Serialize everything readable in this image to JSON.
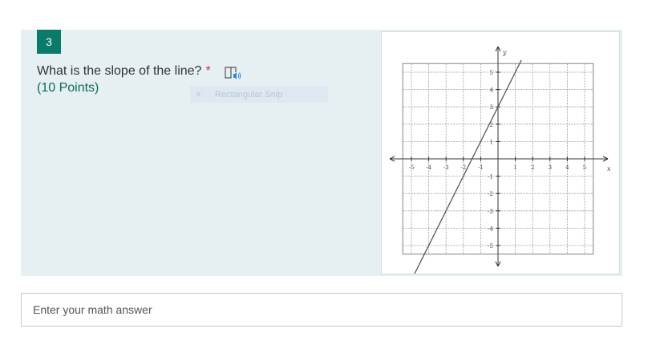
{
  "question": {
    "number": "3",
    "text": "What is the slope of the line?",
    "required_mark": "*",
    "points": "(10 Points)",
    "reader_icon": "immersive-reader-icon"
  },
  "snip_overlay": {
    "label": "Rectangular Snip"
  },
  "graph": {
    "x_label": "x",
    "y_label": "y",
    "x_ticks": [
      "-5",
      "-4",
      "-3",
      "-2",
      "-1",
      "1",
      "2",
      "3",
      "4",
      "5"
    ],
    "y_ticks": [
      "5",
      "4",
      "3",
      "2",
      "1",
      "-1",
      "-2",
      "-3",
      "-4",
      "-5"
    ],
    "line": {
      "slope": 2,
      "y_intercept": 3
    }
  },
  "answer": {
    "placeholder": "Enter your math answer",
    "value": ""
  },
  "colors": {
    "accent": "#0b7a6a",
    "card_bg": "#e6eff2",
    "required": "#c4314b"
  }
}
